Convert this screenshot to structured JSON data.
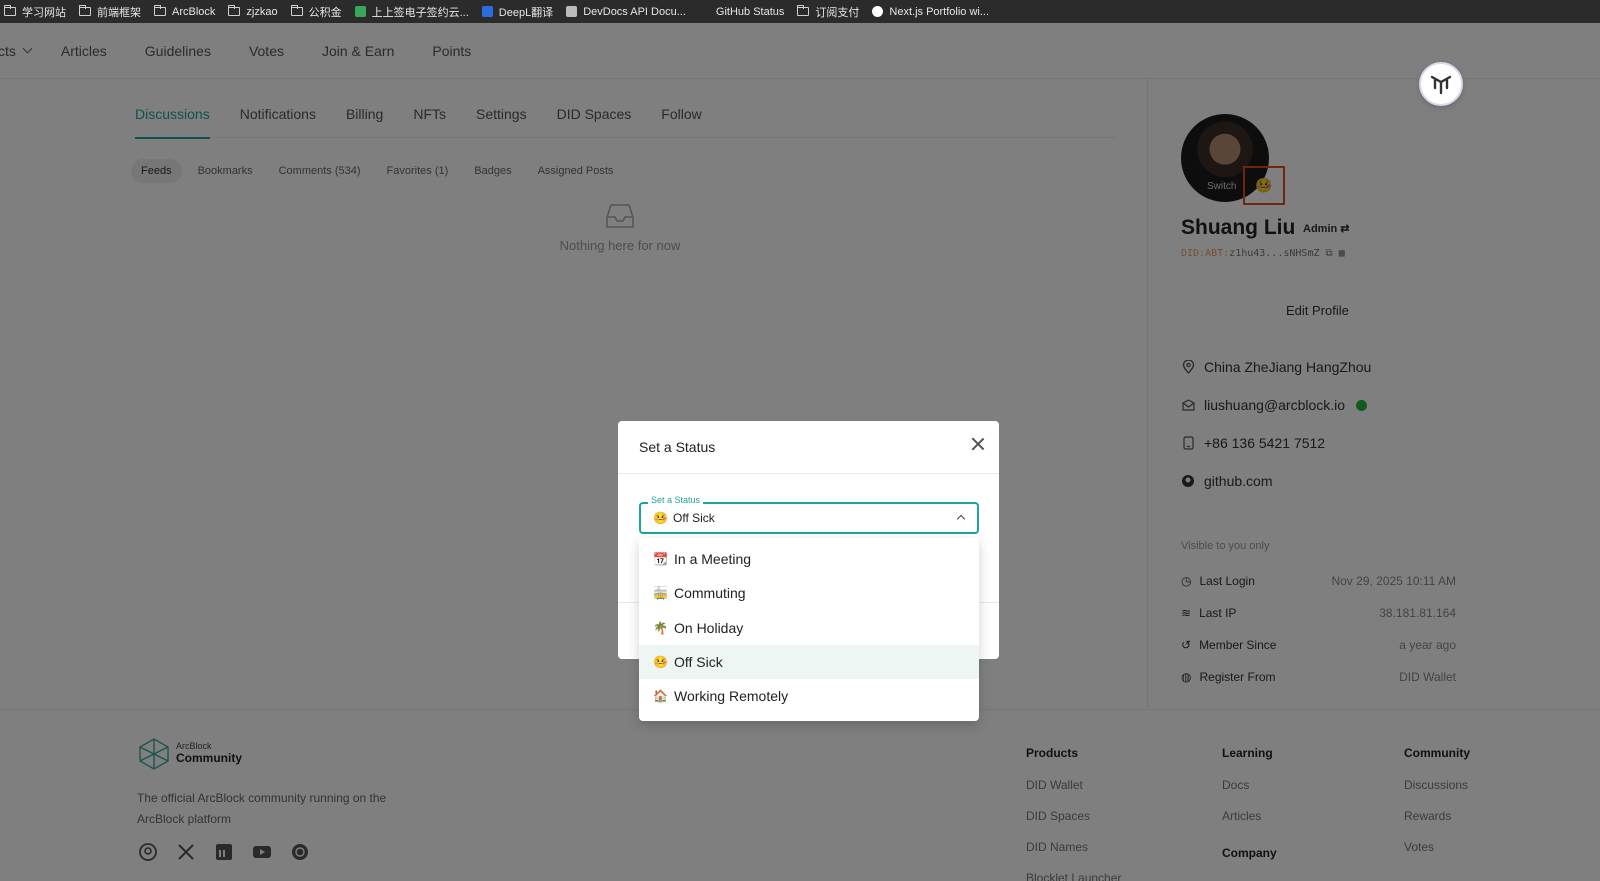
{
  "bookmarks": [
    {
      "label": "学习网站",
      "icon": "folder-icon"
    },
    {
      "label": "前端框架",
      "icon": "folder-icon"
    },
    {
      "label": "ArcBlock",
      "icon": "folder-icon"
    },
    {
      "label": "zjzkao",
      "icon": "folder-icon"
    },
    {
      "label": "公积金",
      "icon": "folder-icon"
    },
    {
      "label": "上上签电子签约云...",
      "icon": "site-icon"
    },
    {
      "label": "DeepL翻译",
      "icon": "site-icon"
    },
    {
      "label": "DevDocs API Docu...",
      "icon": "site-icon"
    },
    {
      "label": "GitHub Status",
      "icon": "site-icon"
    },
    {
      "label": "订阅支付",
      "icon": "folder-icon"
    },
    {
      "label": "Next.js Portfolio wi...",
      "icon": "site-icon"
    }
  ],
  "topnav": {
    "first": "cts",
    "items": [
      "Articles",
      "Guidelines",
      "Votes",
      "Join & Earn",
      "Points"
    ]
  },
  "tabs": [
    "Discussions",
    "Notifications",
    "Billing",
    "NFTs",
    "Settings",
    "DID Spaces",
    "Follow"
  ],
  "subtabs": [
    "Feeds",
    "Bookmarks",
    "Comments (534)",
    "Favorites (1)",
    "Badges",
    "Assigned Posts"
  ],
  "empty_text": "Nothing here for now",
  "profile": {
    "switch_label": "Switch",
    "status_emoji": "🤒",
    "name": "Shuang Liu",
    "role": "Admin",
    "did_prefix": "DID:ABT:",
    "did_value": "z1hu43...sNHSmZ",
    "edit_profile": "Edit Profile",
    "location": "China ZheJiang HangZhou",
    "email": "liushuang@arcblock.io",
    "phone": "+86 136 5421 7512",
    "github": "github.com",
    "visible_note": "Visible to you only",
    "meta": [
      {
        "label": "Last Login",
        "value": "Nov 29, 2025 10:11 AM"
      },
      {
        "label": "Last IP",
        "value": "38.181.81.164"
      },
      {
        "label": "Member Since",
        "value": "a year ago"
      },
      {
        "label": "Register From",
        "value": "DID Wallet"
      }
    ]
  },
  "footer": {
    "brand_small": "ArcBlock",
    "brand_big": "Community",
    "tagline": "The official ArcBlock community running on the ArcBlock platform",
    "products": {
      "heading": "Products",
      "links": [
        "DID Wallet",
        "DID Spaces",
        "DID Names",
        "Blocklet Launcher"
      ]
    },
    "learning": {
      "heading": "Learning",
      "links": [
        "Docs",
        "Articles"
      ]
    },
    "company": {
      "heading": "Company"
    },
    "community": {
      "heading": "Community",
      "links": [
        "Discussions",
        "Rewards",
        "Votes"
      ]
    }
  },
  "dialog": {
    "title": "Set a Status",
    "field_label": "Set a Status",
    "selected": {
      "emoji": "🤒",
      "label": "Off Sick"
    },
    "options": [
      {
        "emoji": "📆",
        "label": "In a Meeting"
      },
      {
        "emoji": "🚋",
        "label": "Commuting"
      },
      {
        "emoji": "🌴",
        "label": "On Holiday"
      },
      {
        "emoji": "🤒",
        "label": "Off Sick"
      },
      {
        "emoji": "🏠",
        "label": "Working Remotely"
      }
    ]
  },
  "colors": {
    "accent": "#1ea59e",
    "highlight_box": "#e34b1f",
    "verified": "#27b43e"
  }
}
